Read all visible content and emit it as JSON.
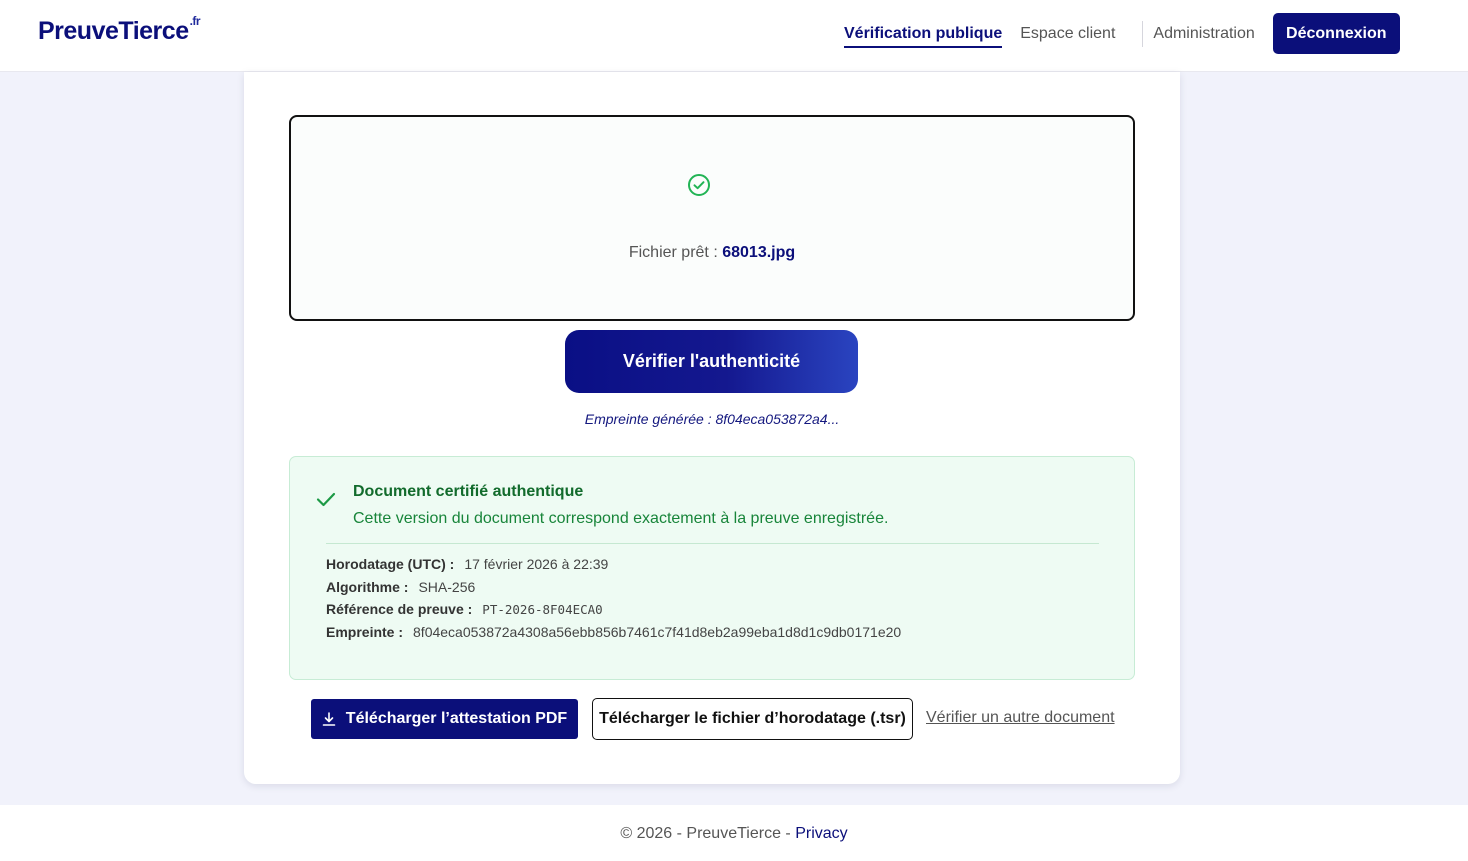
{
  "header": {
    "logo": "PreuveTierce",
    "logo_suffix": ".fr",
    "nav": {
      "public_verification": "Vérification publique",
      "client_space": "Espace client",
      "administration": "Administration",
      "logout": "Déconnexion"
    }
  },
  "dropzone": {
    "label": "Fichier prêt :",
    "filename": "68013.jpg"
  },
  "verify_button": "Vérifier l'authenticité",
  "hash_generated": "Empreinte générée : 8f04eca053872a4...",
  "result": {
    "title": "Document certifié authentique",
    "description": "Cette version du document correspond exactement à la preuve enregistrée.",
    "timestamp_label": "Horodatage (UTC) :",
    "timestamp_value": "17 février 2026 à 22:39",
    "algorithm_label": "Algorithme :",
    "algorithm_value": "SHA-256",
    "reference_label": "Référence de preuve :",
    "reference_value": "PT-2026-8F04ECA0",
    "fingerprint_label": "Empreinte :",
    "fingerprint_value": "8f04eca053872a4308a56ebb856b7461c7f41d8eb2a99eba1d8d1c9db0171e20"
  },
  "actions": {
    "download_pdf": "Télécharger l’attestation PDF",
    "download_tsr": "Télécharger le fichier d’horodatage (.tsr)",
    "verify_other": "Vérifier un autre document"
  },
  "footer": {
    "copyright": "© 2026 - PreuveTierce - ",
    "privacy": "Privacy"
  },
  "colors": {
    "brand": "#0b0f7a",
    "success": "#18853a",
    "success_bg": "#eefbf3"
  }
}
